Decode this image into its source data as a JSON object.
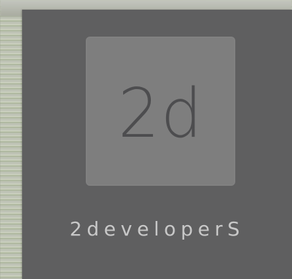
{
  "splash": {
    "logo_text": "2d",
    "brand_name": "2developerS"
  },
  "colors": {
    "panel": "#5f5f60",
    "tile": "#7e7e7e",
    "logo_text": "#4d4d4f",
    "brand_text": "#c8c8c8"
  }
}
